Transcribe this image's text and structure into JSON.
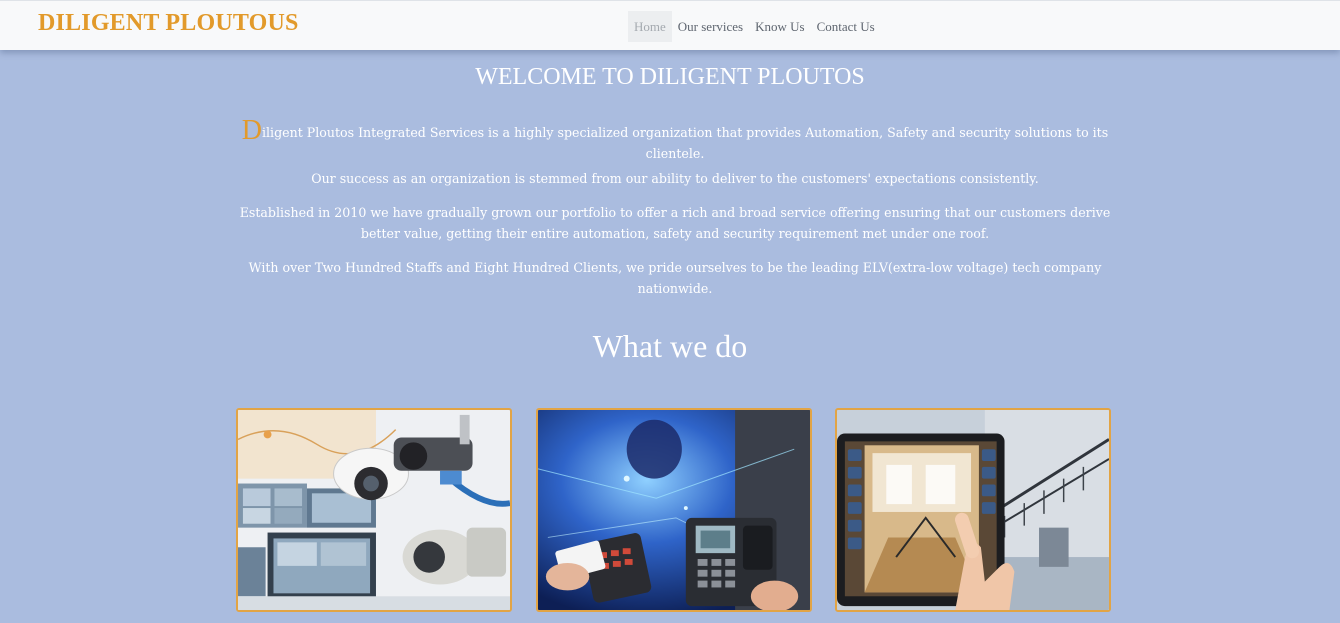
{
  "brand": "DILIGENT PLOUTOUS",
  "nav": {
    "items": [
      "Home",
      "Our services",
      "Know Us",
      "Contact Us"
    ],
    "active": "Home"
  },
  "welcome": "WELCOME TO DILIGENT PLOUTOS",
  "intro": {
    "p1_initial": "D",
    "p1_rest": "iligent Ploutos Integrated Services is a highly specialized organization that provides Automation, Safety and security solutions to its clientele.",
    "p2": "Our success as an organization is stemmed from our ability to deliver to the customers' expectations consistently.",
    "p3": "Established in 2010 we have gradually grown our portfolio to offer a rich and broad service offering ensuring that our customers derive better value, getting their entire automation, safety and security requirement met under one roof.",
    "p4": "With over Two Hundred Staffs and Eight Hundred Clients, we pride ourselves to be the leading ELV(extra-low voltage) tech company nationwide."
  },
  "what_we_do": {
    "title": "What we do",
    "cards": [
      {
        "image": "cctv-cameras-image"
      },
      {
        "image": "access-control-image"
      },
      {
        "image": "home-automation-image"
      }
    ]
  },
  "colors": {
    "background": "#aabcdf",
    "accent": "#e29a2b",
    "navbar": "#f8f9fa"
  }
}
